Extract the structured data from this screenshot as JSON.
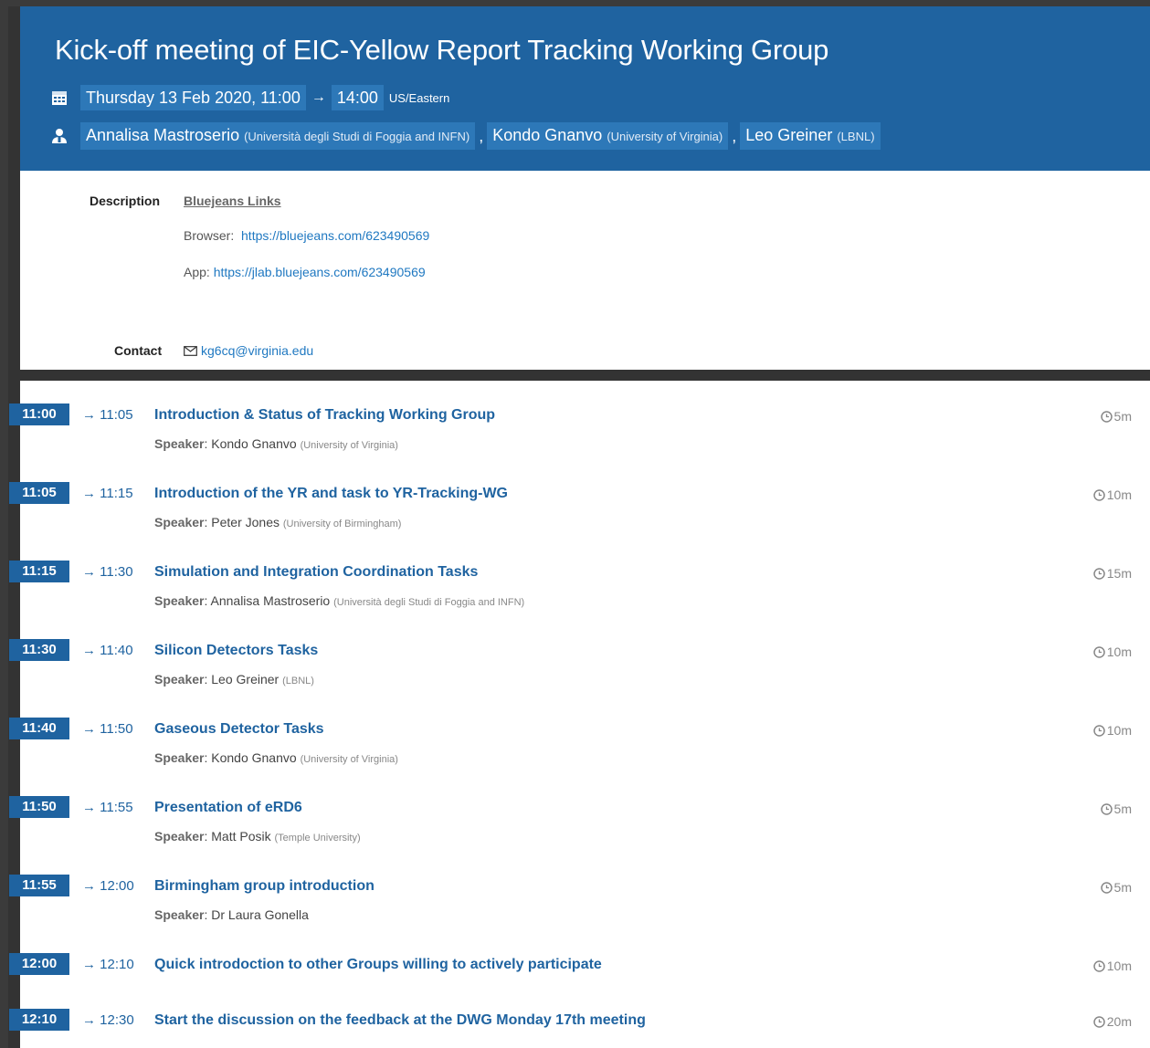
{
  "event": {
    "title": "Kick-off meeting of EIC-Yellow Report Tracking Working Group",
    "date_start": "Thursday 13 Feb 2020, 11:00",
    "arrow": "→",
    "time_end": "14:00",
    "timezone": "US/Eastern",
    "calendar_icon": "calendar-icon",
    "chairs_icon": "person-icon",
    "chairs": [
      {
        "name": "Annalisa Mastroserio",
        "affiliation": "(Università degli Studi di Foggia and INFN)"
      },
      {
        "name": "Kondo Gnanvo",
        "affiliation": "(University of Virginia)"
      },
      {
        "name": "Leo Greiner",
        "affiliation": "(LBNL)"
      }
    ],
    "separator": ","
  },
  "info": {
    "description_label": "Description",
    "description_link": "Bluejeans Links",
    "browser_label": "Browser:",
    "browser_url": "https://bluejeans.com/623490569",
    "app_label": "App:",
    "app_url": "https://jlab.bluejeans.com/623490569",
    "contact_label": "Contact",
    "contact_icon": "mail-icon",
    "contact_email": "kg6cq@virginia.edu"
  },
  "timetable": {
    "speaker_label": "Speaker",
    "duration_icon": "clock-icon",
    "entries": [
      {
        "start": "11:00",
        "end": "→ 11:05",
        "title": "Introduction & Status of Tracking Working Group",
        "speaker": ": Kondo Gnanvo",
        "affiliation": "(University of Virginia)",
        "duration": "5m"
      },
      {
        "start": "11:05",
        "end": "→ 11:15",
        "title": "Introduction of the YR and task to YR-Tracking-WG",
        "speaker": ": Peter Jones",
        "affiliation": "(University of Birmingham)",
        "duration": "10m"
      },
      {
        "start": "11:15",
        "end": "→ 11:30",
        "title": "Simulation and Integration Coordination Tasks",
        "speaker": ": Annalisa Mastroserio",
        "affiliation": "(Università degli Studi di Foggia and INFN)",
        "duration": "15m"
      },
      {
        "start": "11:30",
        "end": "→ 11:40",
        "title": "Silicon Detectors Tasks",
        "speaker": ": Leo Greiner",
        "affiliation": "(LBNL)",
        "duration": "10m"
      },
      {
        "start": "11:40",
        "end": "→ 11:50",
        "title": "Gaseous Detector Tasks",
        "speaker": ": Kondo Gnanvo",
        "affiliation": "(University of Virginia)",
        "duration": "10m"
      },
      {
        "start": "11:50",
        "end": "→ 11:55",
        "title": "Presentation of eRD6",
        "speaker": ": Matt Posik",
        "affiliation": "(Temple University)",
        "duration": "5m"
      },
      {
        "start": "11:55",
        "end": "→ 12:00",
        "title": "Birmingham group introduction",
        "speaker": ": Dr Laura Gonella",
        "affiliation": "",
        "duration": "5m"
      },
      {
        "start": "12:00",
        "end": "→ 12:10",
        "title": "Quick introdoction to other Groups willing to actively participate",
        "speaker": "",
        "affiliation": "",
        "duration": "10m"
      },
      {
        "start": "12:10",
        "end": "→ 12:30",
        "title": "Start the discussion on the feedback at the DWG Monday 17th meeting",
        "speaker": "",
        "affiliation": "",
        "duration": "20m"
      }
    ]
  }
}
